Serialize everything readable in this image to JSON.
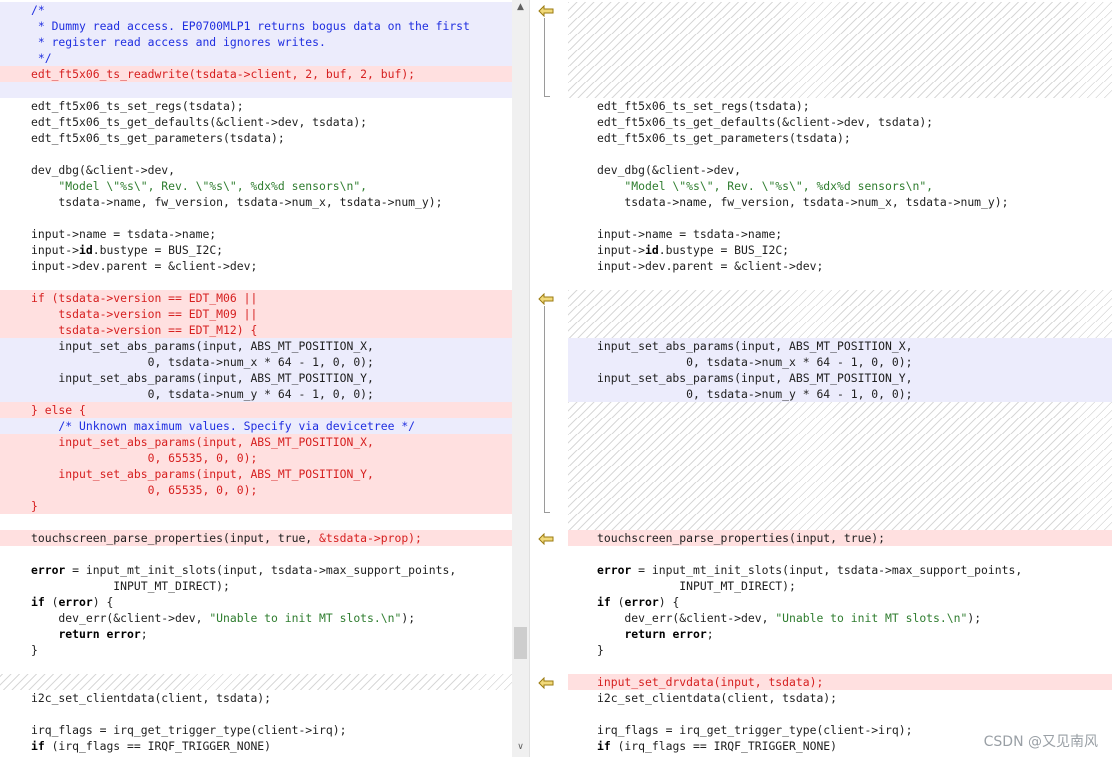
{
  "left": [
    {
      "text": "/*",
      "type": "chg",
      "cls": "c-cmt"
    },
    {
      "text": " * Dummy read access. EP0700MLP1 returns bogus data on the first",
      "type": "chg",
      "cls": "c-cmt"
    },
    {
      "text": " * register read access and ignores writes.",
      "type": "chg",
      "cls": "c-cmt"
    },
    {
      "text": " */",
      "type": "chg",
      "cls": "c-cmt"
    },
    {
      "text": "edt_ft5x06_ts_readwrite(tsdata->client, 2, buf, 2, buf);",
      "type": "del"
    },
    {
      "text": "",
      "type": "chg"
    },
    {
      "text": "edt_ft5x06_ts_set_regs(tsdata);",
      "type": ""
    },
    {
      "text": "edt_ft5x06_ts_get_defaults(&client->dev, tsdata);",
      "type": ""
    },
    {
      "text": "edt_ft5x06_ts_get_parameters(tsdata);",
      "type": ""
    },
    {
      "text": "",
      "type": ""
    },
    {
      "text": "dev_dbg(&client->dev,",
      "type": ""
    },
    {
      "text": "    \"Model \\\"%s\\\", Rev. \\\"%s\\\", %dx%d sensors\\n\",",
      "type": "",
      "cls": "c-str"
    },
    {
      "text": "    tsdata->name, fw_version, tsdata->num_x, tsdata->num_y);",
      "type": ""
    },
    {
      "text": "",
      "type": ""
    },
    {
      "text": "input->name = tsdata->name;",
      "type": ""
    },
    {
      "text": "input->id.bustype = BUS_I2C;",
      "type": ""
    },
    {
      "text": "input->dev.parent = &client->dev;",
      "type": ""
    },
    {
      "text": "",
      "type": ""
    },
    {
      "text": "if (tsdata->version == EDT_M06 ||",
      "type": "del"
    },
    {
      "text": "    tsdata->version == EDT_M09 ||",
      "type": "del"
    },
    {
      "text": "    tsdata->version == EDT_M12) {",
      "type": "del"
    },
    {
      "text": "    input_set_abs_params(input, ABS_MT_POSITION_X,",
      "type": "chg"
    },
    {
      "text": "                 0, tsdata->num_x * 64 - 1, 0, 0);",
      "type": "chg"
    },
    {
      "text": "    input_set_abs_params(input, ABS_MT_POSITION_Y,",
      "type": "chg"
    },
    {
      "text": "                 0, tsdata->num_y * 64 - 1, 0, 0);",
      "type": "chg"
    },
    {
      "text": "} else {",
      "type": "del"
    },
    {
      "text": "    /* Unknown maximum values. Specify via devicetree */",
      "type": "chg",
      "cls": "c-cmt"
    },
    {
      "text": "    input_set_abs_params(input, ABS_MT_POSITION_X,",
      "type": "del"
    },
    {
      "text": "                 0, 65535, 0, 0);",
      "type": "del"
    },
    {
      "text": "    input_set_abs_params(input, ABS_MT_POSITION_Y,",
      "type": "del"
    },
    {
      "text": "                 0, 65535, 0, 0);",
      "type": "del"
    },
    {
      "text": "}",
      "type": "del"
    },
    {
      "text": "",
      "type": ""
    },
    {
      "text": "touchscreen_parse_properties(input, true, &tsdata->prop);",
      "type": "del",
      "plain_prefix": "touchscreen_parse_properties(input, true, "
    },
    {
      "text": "",
      "type": ""
    },
    {
      "text": "error = input_mt_init_slots(input, tsdata->max_support_points,",
      "type": ""
    },
    {
      "text": "            INPUT_MT_DIRECT);",
      "type": ""
    },
    {
      "text": "if (error) {",
      "type": ""
    },
    {
      "text": "    dev_err(&client->dev, \"Unable to init MT slots.\\n\");",
      "type": ""
    },
    {
      "text": "    return error;",
      "type": ""
    },
    {
      "text": "}",
      "type": ""
    },
    {
      "text": "",
      "type": ""
    },
    {
      "text": "",
      "type": "hatch"
    },
    {
      "text": "i2c_set_clientdata(client, tsdata);",
      "type": ""
    },
    {
      "text": "",
      "type": ""
    },
    {
      "text": "irq_flags = irq_get_trigger_type(client->irq);",
      "type": ""
    },
    {
      "text": "if (irq_flags == IRQF_TRIGGER_NONE)",
      "type": ""
    }
  ],
  "right": [
    {
      "text": "",
      "type": "hatch"
    },
    {
      "text": "",
      "type": "hatch"
    },
    {
      "text": "",
      "type": "hatch"
    },
    {
      "text": "",
      "type": "hatch"
    },
    {
      "text": "",
      "type": "hatch"
    },
    {
      "text": "",
      "type": "hatch"
    },
    {
      "text": "edt_ft5x06_ts_set_regs(tsdata);",
      "type": ""
    },
    {
      "text": "edt_ft5x06_ts_get_defaults(&client->dev, tsdata);",
      "type": ""
    },
    {
      "text": "edt_ft5x06_ts_get_parameters(tsdata);",
      "type": ""
    },
    {
      "text": "",
      "type": ""
    },
    {
      "text": "dev_dbg(&client->dev,",
      "type": ""
    },
    {
      "text": "    \"Model \\\"%s\\\", Rev. \\\"%s\\\", %dx%d sensors\\n\",",
      "type": "",
      "cls": "c-str"
    },
    {
      "text": "    tsdata->name, fw_version, tsdata->num_x, tsdata->num_y);",
      "type": ""
    },
    {
      "text": "",
      "type": ""
    },
    {
      "text": "input->name = tsdata->name;",
      "type": ""
    },
    {
      "text": "input->id.bustype = BUS_I2C;",
      "type": ""
    },
    {
      "text": "input->dev.parent = &client->dev;",
      "type": ""
    },
    {
      "text": "",
      "type": ""
    },
    {
      "text": "",
      "type": "hatch"
    },
    {
      "text": "",
      "type": "hatch"
    },
    {
      "text": "",
      "type": "hatch"
    },
    {
      "text": "input_set_abs_params(input, ABS_MT_POSITION_X,",
      "type": "chg"
    },
    {
      "text": "             0, tsdata->num_x * 64 - 1, 0, 0);",
      "type": "chg"
    },
    {
      "text": "input_set_abs_params(input, ABS_MT_POSITION_Y,",
      "type": "chg"
    },
    {
      "text": "             0, tsdata->num_y * 64 - 1, 0, 0);",
      "type": "chg"
    },
    {
      "text": "",
      "type": "hatch"
    },
    {
      "text": "",
      "type": "hatch"
    },
    {
      "text": "",
      "type": "hatch"
    },
    {
      "text": "",
      "type": "hatch"
    },
    {
      "text": "",
      "type": "hatch"
    },
    {
      "text": "",
      "type": "hatch"
    },
    {
      "text": "",
      "type": "hatch"
    },
    {
      "text": "",
      "type": "hatch"
    },
    {
      "text": "touchscreen_parse_properties(input, true);",
      "type": "del-plain"
    },
    {
      "text": "",
      "type": ""
    },
    {
      "text": "error = input_mt_init_slots(input, tsdata->max_support_points,",
      "type": ""
    },
    {
      "text": "            INPUT_MT_DIRECT);",
      "type": ""
    },
    {
      "text": "if (error) {",
      "type": ""
    },
    {
      "text": "    dev_err(&client->dev, \"Unable to init MT slots.\\n\");",
      "type": ""
    },
    {
      "text": "    return error;",
      "type": ""
    },
    {
      "text": "}",
      "type": ""
    },
    {
      "text": "",
      "type": ""
    },
    {
      "text": "input_set_drvdata(input, tsdata);",
      "type": "del"
    },
    {
      "text": "i2c_set_clientdata(client, tsdata);",
      "type": ""
    },
    {
      "text": "",
      "type": ""
    },
    {
      "text": "irq_flags = irq_get_trigger_type(client->irq);",
      "type": ""
    },
    {
      "text": "if (irq_flags == IRQF_TRIGGER_NONE)",
      "type": ""
    }
  ],
  "gutter_markers": [
    "arrow-left-icon",
    "arrow-left-icon",
    "arrow-left-icon",
    "arrow-left-icon"
  ],
  "watermark": "CSDN @又见南风",
  "colors": {
    "deleted": "#ffe0e0",
    "changed": "#ececfc",
    "marker": "#e8c34a"
  }
}
